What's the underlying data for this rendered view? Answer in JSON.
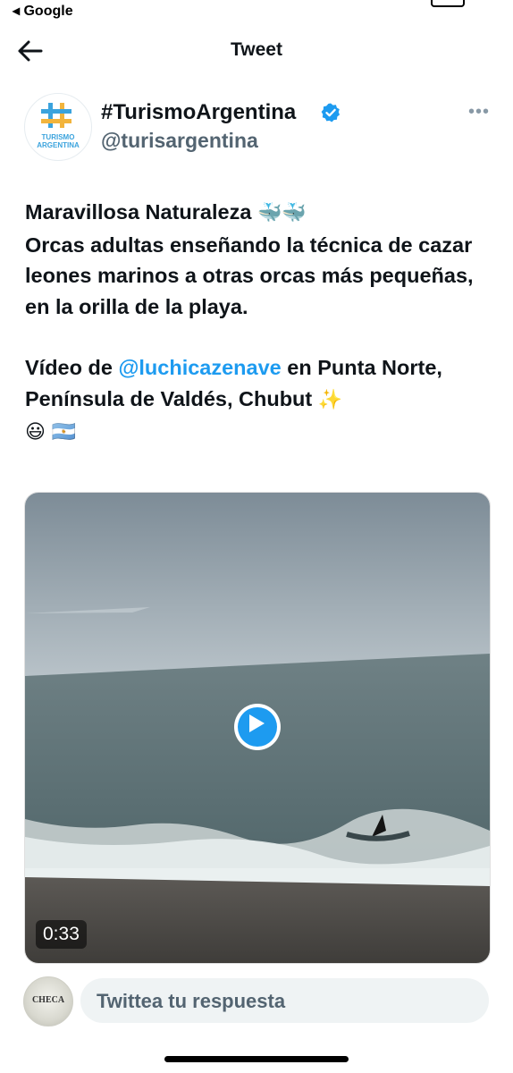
{
  "status_bar": {
    "back_app": "◂ Google"
  },
  "nav": {
    "title": "Tweet"
  },
  "account": {
    "display_name": "#TurismoArgentina",
    "handle": "@turisargentina",
    "avatar_text": "TURISMO ARGENTINA",
    "verified": true,
    "verified_color": "#1d9bf0"
  },
  "tweet": {
    "line1_text": "Maravillosa Naturaleza ",
    "line1_emoji": "🐳🐳",
    "line2": "Orcas adultas enseñando la técnica de cazar leones marinos a otras orcas más pequeñas, en la orilla de la playa.",
    "video_prefix": "Vídeo de ",
    "mention": "@luchicazenave",
    "video_suffix": "  en Punta Norte, Península de Valdés, Chubut ",
    "sparkle_emoji": "✨",
    "end_emoji": "😃 🇦🇷"
  },
  "media": {
    "duration": "0:33",
    "play_icon": "play-icon"
  },
  "reply": {
    "placeholder": "Twittea tu respuesta",
    "avatar_text": "CHECA"
  },
  "colors": {
    "link": "#1d9bf0",
    "muted": "#536471",
    "text": "#0f1419"
  }
}
